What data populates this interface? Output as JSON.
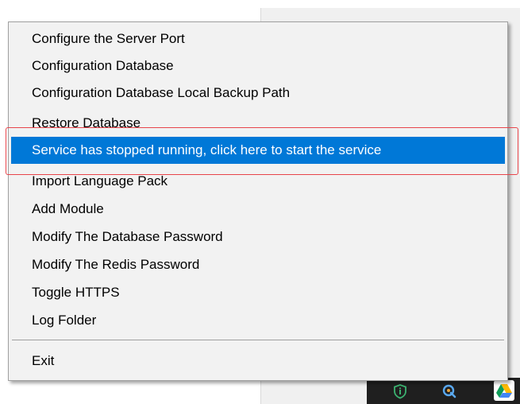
{
  "menu": {
    "items": [
      {
        "label": "Configure the Server Port",
        "highlighted": false
      },
      {
        "label": "Configuration Database",
        "highlighted": false
      },
      {
        "label": "Configuration Database Local Backup Path",
        "highlighted": false
      },
      {
        "label": "Restore Database",
        "highlighted": false
      },
      {
        "label": "Service has stopped running, click here to start the service",
        "highlighted": true
      },
      {
        "label": "Import Language Pack",
        "highlighted": false
      },
      {
        "label": "Add Module",
        "highlighted": false
      },
      {
        "label": "Modify The Database Password",
        "highlighted": false
      },
      {
        "label": "Modify The Redis Password",
        "highlighted": false
      },
      {
        "label": "Toggle HTTPS",
        "highlighted": false
      },
      {
        "label": "Log Folder",
        "highlighted": false
      }
    ],
    "exit_label": "Exit"
  },
  "tray": {
    "icons": [
      "shield-icon",
      "sync-icon",
      "google-drive-icon"
    ]
  },
  "colors": {
    "highlight": "#0078d7",
    "annotation": "#e8454b",
    "menu_background": "#f2f2f2"
  }
}
